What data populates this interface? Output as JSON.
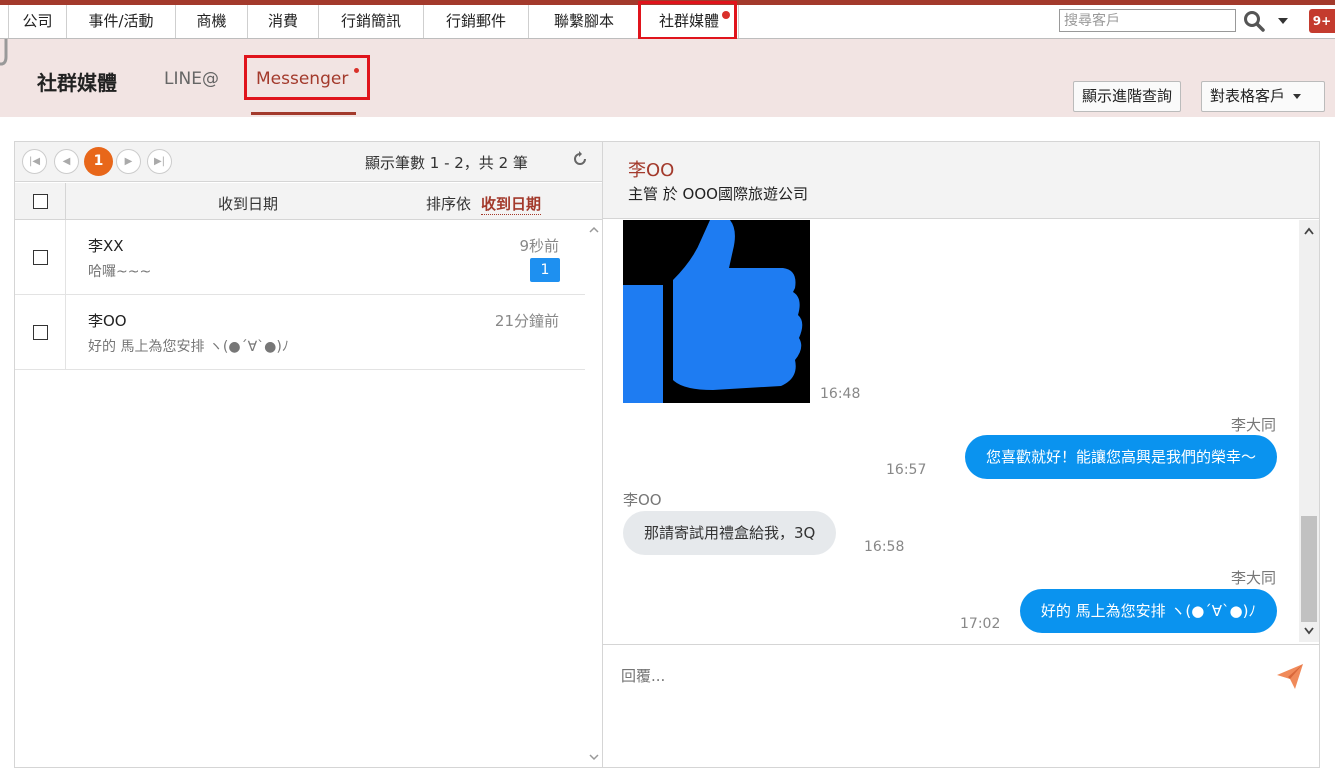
{
  "nav": {
    "items": [
      {
        "label": "公司",
        "w": 56
      },
      {
        "label": "事件/活動",
        "w": 109
      },
      {
        "label": "商機",
        "w": 72
      },
      {
        "label": "消費",
        "w": 71
      },
      {
        "label": "行銷簡訊",
        "w": 105
      },
      {
        "label": "行銷郵件",
        "w": 105
      },
      {
        "label": "聯繫腳本",
        "w": 113
      },
      {
        "label": "社群媒體",
        "w": 102
      }
    ],
    "search_placeholder": "搜尋客戶",
    "notif_count": "9+"
  },
  "sub": {
    "title": "社群媒體",
    "tab_line": "LINE@",
    "tab_messenger": "Messenger",
    "btn_advanced": "顯示進階查詢",
    "btn_table": "對表格客戶"
  },
  "list": {
    "page": "1",
    "info": "顯示筆數 1 - 2，共 2 筆",
    "col_date": "收到日期",
    "sort_label": "排序依",
    "sort_value": "收到日期",
    "rows": [
      {
        "name": "李XX",
        "preview": "哈囉~~~",
        "time": "9秒前",
        "badge": "1"
      },
      {
        "name": "李OO",
        "preview": "好的 馬上為您安排 ヽ(●´∀`●)ﾉ",
        "time": "21分鐘前"
      }
    ]
  },
  "chat": {
    "contact_name": "李OO",
    "contact_sub": "主管 於 OOO國際旅遊公司",
    "img_time": "16:48",
    "msg1_sender": "李大同",
    "msg1_text": "您喜歡就好！能讓您高興是我們的榮幸～",
    "msg1_time": "16:57",
    "msg2_sender": "李OO",
    "msg2_text": "那請寄試用禮盒給我，3Q",
    "msg2_time": "16:58",
    "msg3_sender": "李大同",
    "msg3_text": "好的 馬上為您安排 ヽ(●´∀`●)ﾉ",
    "msg3_time": "17:02",
    "reply_placeholder": "回覆..."
  },
  "colors": {
    "brand": "#a33a2c",
    "accent": "#0a93ef",
    "highlight": "#e0141c",
    "pager_current": "#e8671a"
  }
}
